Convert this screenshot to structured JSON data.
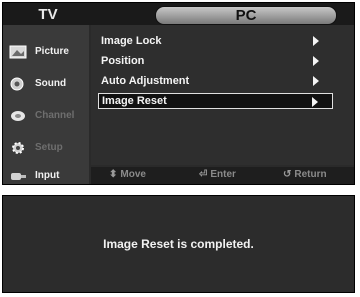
{
  "header": {
    "tv_label": "TV",
    "pc_tab": "PC"
  },
  "sidebar": {
    "items": [
      {
        "label": "Picture",
        "icon": "picture-icon"
      },
      {
        "label": "Sound",
        "icon": "speaker-icon"
      },
      {
        "label": "Channel",
        "icon": "satellite-dish-icon"
      },
      {
        "label": "Setup",
        "icon": "gear-icon"
      },
      {
        "label": "Input",
        "icon": "input-plug-icon"
      }
    ]
  },
  "menu": {
    "items": [
      {
        "label": "Image Lock"
      },
      {
        "label": "Position"
      },
      {
        "label": "Auto Adjustment"
      },
      {
        "label": "Image Reset",
        "selected": true
      }
    ]
  },
  "help": {
    "move": "Move",
    "enter": "Enter",
    "return": "Return"
  },
  "message": {
    "text": "Image Reset is completed."
  },
  "colors": {
    "panel": "#2a2a2a",
    "highlight_border": "#e0e0e0",
    "text": "#f4f4f4"
  }
}
